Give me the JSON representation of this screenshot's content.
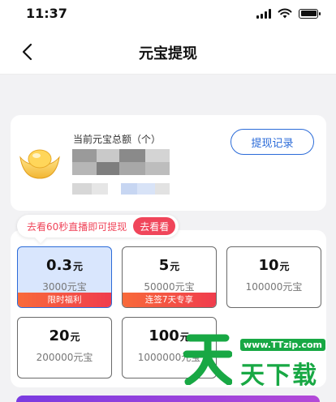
{
  "status_bar": {
    "time": "11:37"
  },
  "nav": {
    "title": "元宝提现"
  },
  "balance": {
    "label": "当前元宝总额（个）",
    "records_button": "提现记录"
  },
  "promo": {
    "text": "去看60秒直播即可提现",
    "button": "去看看"
  },
  "options": [
    {
      "value": "0.3",
      "unit": "元",
      "sub": "3000元宝",
      "tag": "限时福利",
      "selected": true
    },
    {
      "value": "5",
      "unit": "元",
      "sub": "50000元宝",
      "tag": "连签7天专享",
      "selected": false
    },
    {
      "value": "10",
      "unit": "元",
      "sub": "100000元宝",
      "tag": "",
      "selected": false
    },
    {
      "value": "20",
      "unit": "元",
      "sub": "200000元宝",
      "tag": "",
      "selected": false
    },
    {
      "value": "100",
      "unit": "元",
      "sub": "1000000元宝",
      "tag": "",
      "selected": false
    }
  ],
  "watermark": {
    "url": "www.TTzip.com",
    "text": "天下载"
  },
  "colors": {
    "accent": "#2b6bd8",
    "promo": "#f0455a",
    "selected_bg": "#d9e6fd",
    "tag_gradient_start": "#f86a3a",
    "tag_gradient_end": "#f03c4d"
  }
}
